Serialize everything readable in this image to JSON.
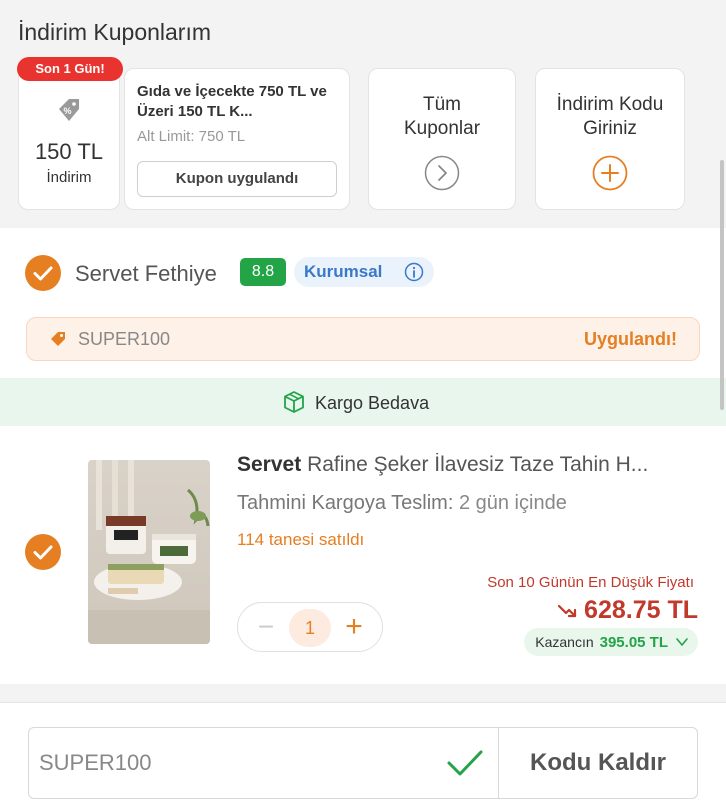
{
  "coupons": {
    "title": "İndirim Kuponlarım",
    "main_coupon": {
      "badge": "Son 1 Gün!",
      "amount": "150 TL",
      "amount_label": "İndirim",
      "title": "Gıda ve İçecekte 750 TL ve Üzeri 150 TL K...",
      "limit": "Alt Limit: 750 TL",
      "button": "Kupon uygulandı",
      "icon": "percent-tag-icon"
    },
    "all_coupons": {
      "label": "Tüm Kuponlar",
      "icon": "chevron-right-circle-icon"
    },
    "enter_code": {
      "label": "İndirim Kodu Giriniz",
      "icon": "plus-circle-icon"
    }
  },
  "seller": {
    "name": "Servet Fethiye",
    "rating": "8.8",
    "type": "Kurumsal",
    "promo_code": "SUPER100",
    "promo_status": "Uygulandı!"
  },
  "shipping": {
    "label": "Kargo Bedava",
    "icon": "package-icon"
  },
  "product": {
    "brand": "Servet",
    "name": "Rafine Şeker İlavesiz Taze Tahin H...",
    "delivery_label": "Tahmini Kargoya Teslim:",
    "delivery_value": "2 gün içinde",
    "sold": "114 tanesi satıldı",
    "quantity": "1",
    "lowest_label": "Son 10 Günün En Düşük Fiyatı",
    "price": "628.75 TL",
    "earn_label": "Kazancın",
    "earn_value": "395.05 TL"
  },
  "bottom": {
    "code_value": "SUPER100",
    "remove_label": "Kodu Kaldır"
  },
  "colors": {
    "accent": "#e67e22",
    "success": "#22a447",
    "danger": "#c0392b",
    "badge_red": "#e8332f",
    "info_blue": "#3a78c8"
  }
}
